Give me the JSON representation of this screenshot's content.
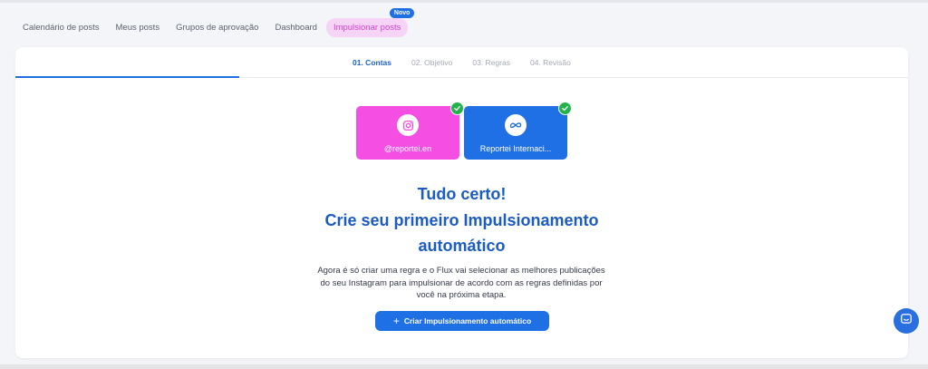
{
  "nav": {
    "items": [
      {
        "label": "Calendário de posts"
      },
      {
        "label": "Meus posts"
      },
      {
        "label": "Grupos de aprovação"
      },
      {
        "label": "Dashboard"
      },
      {
        "label": "Impulsionar posts",
        "badge": "Novo"
      }
    ]
  },
  "steps": [
    {
      "label": "01. Contas",
      "active": true
    },
    {
      "label": "02. Objetivo"
    },
    {
      "label": "03. Regras"
    },
    {
      "label": "04. Revisão"
    }
  ],
  "accounts": [
    {
      "label": "@reportei.en",
      "icon": "instagram-icon",
      "color": "#f54ee3",
      "selected": true
    },
    {
      "label": "Reportei Internaci...",
      "icon": "meta-icon",
      "color": "#1f6fe5",
      "selected": true
    }
  ],
  "main": {
    "title_line1": "Tudo certo!",
    "title_line2": "Crie seu primeiro Impulsionamento",
    "title_line3": "automático",
    "desc_line1": "Agora é só criar uma regra e o Flux vai selecionar as melhores publicações",
    "desc_line2": "do seu Instagram para impulsionar de acordo com as regras definidas por",
    "desc_line3": "você na próxima etapa.",
    "cta_label": "Criar Impulsionamento automático"
  },
  "colors": {
    "accent": "#1f6fe5",
    "instagram": "#f54ee3",
    "success": "#22b34a",
    "title": "#1a5bc4"
  }
}
